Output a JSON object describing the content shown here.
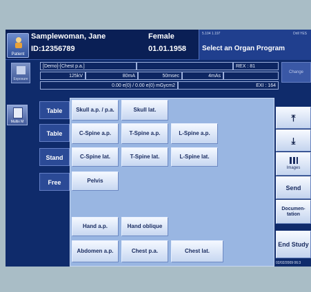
{
  "header": {
    "patient_label": "Patient",
    "name": "Samplewoman, Jane",
    "id": "ID:12356789",
    "sex": "Female",
    "dob": "01.01.1958",
    "code_left": "5.104 1.197",
    "code_right": "Drill YES",
    "prompt": "Select an Organ Program"
  },
  "exposure": {
    "program": "[Demo]-[Chest p.a.]",
    "rex": "REX : 81",
    "kv": "125kV",
    "ma": "80mA",
    "msec": "50msec",
    "mas": "4mAs",
    "dose": "0.00 e(0) / 0.00 e(0) mGycm2",
    "ei": "EXI : 164",
    "change_label": "Change",
    "expo_label": "Exposure"
  },
  "tabs": [
    "Table",
    "Table",
    "Stand",
    "Free"
  ],
  "side": {
    "multix_label": "Multix M"
  },
  "exams": {
    "skull_ap": "Skull a.p. / p.a.",
    "skull_lat": "Skull lat.",
    "cspine_ap": "C-Spine a.p.",
    "tspine_ap": "T-Spine a.p.",
    "lspine_ap": "L-Spine a.p.",
    "cspine_lat": "C-Spine lat.",
    "tspine_lat": "T-Spine lat.",
    "lspine_lat": "L-Spine lat.",
    "pelvis": "Pelvis",
    "hand_ap": "Hand a.p.",
    "hand_oblique": "Hand oblique",
    "abdomen_ap": "Abdomen a.p.",
    "chest_pa": "Chest p.a.",
    "chest_lat": "Chest lat."
  },
  "right_panel": {
    "up_icon": "skip-up-icon",
    "down_icon": "skip-down-icon",
    "images": "Images",
    "send": "Send",
    "documentation": "Documen- tation",
    "end_study": "End Study",
    "datetime": "02/02/2009 06:3"
  }
}
